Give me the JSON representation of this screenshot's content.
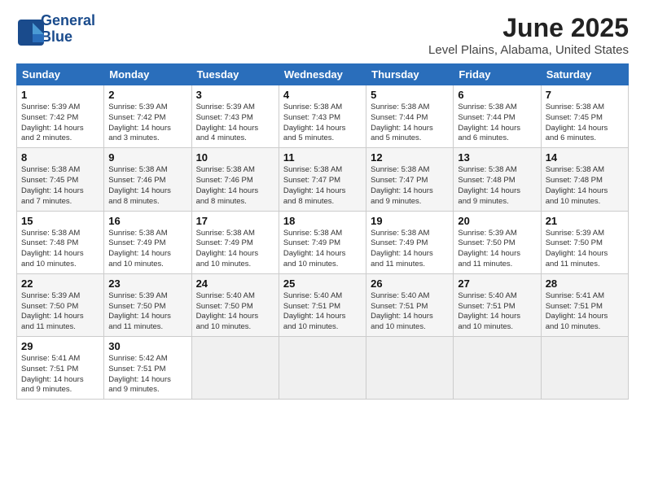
{
  "logo": {
    "line1": "General",
    "line2": "Blue"
  },
  "title": "June 2025",
  "subtitle": "Level Plains, Alabama, United States",
  "header_days": [
    "Sunday",
    "Monday",
    "Tuesday",
    "Wednesday",
    "Thursday",
    "Friday",
    "Saturday"
  ],
  "weeks": [
    [
      {
        "day": "1",
        "lines": [
          "Sunrise: 5:39 AM",
          "Sunset: 7:42 PM",
          "Daylight: 14 hours",
          "and 2 minutes."
        ]
      },
      {
        "day": "2",
        "lines": [
          "Sunrise: 5:39 AM",
          "Sunset: 7:42 PM",
          "Daylight: 14 hours",
          "and 3 minutes."
        ]
      },
      {
        "day": "3",
        "lines": [
          "Sunrise: 5:39 AM",
          "Sunset: 7:43 PM",
          "Daylight: 14 hours",
          "and 4 minutes."
        ]
      },
      {
        "day": "4",
        "lines": [
          "Sunrise: 5:38 AM",
          "Sunset: 7:43 PM",
          "Daylight: 14 hours",
          "and 5 minutes."
        ]
      },
      {
        "day": "5",
        "lines": [
          "Sunrise: 5:38 AM",
          "Sunset: 7:44 PM",
          "Daylight: 14 hours",
          "and 5 minutes."
        ]
      },
      {
        "day": "6",
        "lines": [
          "Sunrise: 5:38 AM",
          "Sunset: 7:44 PM",
          "Daylight: 14 hours",
          "and 6 minutes."
        ]
      },
      {
        "day": "7",
        "lines": [
          "Sunrise: 5:38 AM",
          "Sunset: 7:45 PM",
          "Daylight: 14 hours",
          "and 6 minutes."
        ]
      }
    ],
    [
      {
        "day": "8",
        "lines": [
          "Sunrise: 5:38 AM",
          "Sunset: 7:45 PM",
          "Daylight: 14 hours",
          "and 7 minutes."
        ]
      },
      {
        "day": "9",
        "lines": [
          "Sunrise: 5:38 AM",
          "Sunset: 7:46 PM",
          "Daylight: 14 hours",
          "and 8 minutes."
        ]
      },
      {
        "day": "10",
        "lines": [
          "Sunrise: 5:38 AM",
          "Sunset: 7:46 PM",
          "Daylight: 14 hours",
          "and 8 minutes."
        ]
      },
      {
        "day": "11",
        "lines": [
          "Sunrise: 5:38 AM",
          "Sunset: 7:47 PM",
          "Daylight: 14 hours",
          "and 8 minutes."
        ]
      },
      {
        "day": "12",
        "lines": [
          "Sunrise: 5:38 AM",
          "Sunset: 7:47 PM",
          "Daylight: 14 hours",
          "and 9 minutes."
        ]
      },
      {
        "day": "13",
        "lines": [
          "Sunrise: 5:38 AM",
          "Sunset: 7:48 PM",
          "Daylight: 14 hours",
          "and 9 minutes."
        ]
      },
      {
        "day": "14",
        "lines": [
          "Sunrise: 5:38 AM",
          "Sunset: 7:48 PM",
          "Daylight: 14 hours",
          "and 10 minutes."
        ]
      }
    ],
    [
      {
        "day": "15",
        "lines": [
          "Sunrise: 5:38 AM",
          "Sunset: 7:48 PM",
          "Daylight: 14 hours",
          "and 10 minutes."
        ]
      },
      {
        "day": "16",
        "lines": [
          "Sunrise: 5:38 AM",
          "Sunset: 7:49 PM",
          "Daylight: 14 hours",
          "and 10 minutes."
        ]
      },
      {
        "day": "17",
        "lines": [
          "Sunrise: 5:38 AM",
          "Sunset: 7:49 PM",
          "Daylight: 14 hours",
          "and 10 minutes."
        ]
      },
      {
        "day": "18",
        "lines": [
          "Sunrise: 5:38 AM",
          "Sunset: 7:49 PM",
          "Daylight: 14 hours",
          "and 10 minutes."
        ]
      },
      {
        "day": "19",
        "lines": [
          "Sunrise: 5:38 AM",
          "Sunset: 7:49 PM",
          "Daylight: 14 hours",
          "and 11 minutes."
        ]
      },
      {
        "day": "20",
        "lines": [
          "Sunrise: 5:39 AM",
          "Sunset: 7:50 PM",
          "Daylight: 14 hours",
          "and 11 minutes."
        ]
      },
      {
        "day": "21",
        "lines": [
          "Sunrise: 5:39 AM",
          "Sunset: 7:50 PM",
          "Daylight: 14 hours",
          "and 11 minutes."
        ]
      }
    ],
    [
      {
        "day": "22",
        "lines": [
          "Sunrise: 5:39 AM",
          "Sunset: 7:50 PM",
          "Daylight: 14 hours",
          "and 11 minutes."
        ]
      },
      {
        "day": "23",
        "lines": [
          "Sunrise: 5:39 AM",
          "Sunset: 7:50 PM",
          "Daylight: 14 hours",
          "and 11 minutes."
        ]
      },
      {
        "day": "24",
        "lines": [
          "Sunrise: 5:40 AM",
          "Sunset: 7:50 PM",
          "Daylight: 14 hours",
          "and 10 minutes."
        ]
      },
      {
        "day": "25",
        "lines": [
          "Sunrise: 5:40 AM",
          "Sunset: 7:51 PM",
          "Daylight: 14 hours",
          "and 10 minutes."
        ]
      },
      {
        "day": "26",
        "lines": [
          "Sunrise: 5:40 AM",
          "Sunset: 7:51 PM",
          "Daylight: 14 hours",
          "and 10 minutes."
        ]
      },
      {
        "day": "27",
        "lines": [
          "Sunrise: 5:40 AM",
          "Sunset: 7:51 PM",
          "Daylight: 14 hours",
          "and 10 minutes."
        ]
      },
      {
        "day": "28",
        "lines": [
          "Sunrise: 5:41 AM",
          "Sunset: 7:51 PM",
          "Daylight: 14 hours",
          "and 10 minutes."
        ]
      }
    ],
    [
      {
        "day": "29",
        "lines": [
          "Sunrise: 5:41 AM",
          "Sunset: 7:51 PM",
          "Daylight: 14 hours",
          "and 9 minutes."
        ]
      },
      {
        "day": "30",
        "lines": [
          "Sunrise: 5:42 AM",
          "Sunset: 7:51 PM",
          "Daylight: 14 hours",
          "and 9 minutes."
        ]
      },
      {
        "day": "",
        "lines": []
      },
      {
        "day": "",
        "lines": []
      },
      {
        "day": "",
        "lines": []
      },
      {
        "day": "",
        "lines": []
      },
      {
        "day": "",
        "lines": []
      }
    ]
  ]
}
